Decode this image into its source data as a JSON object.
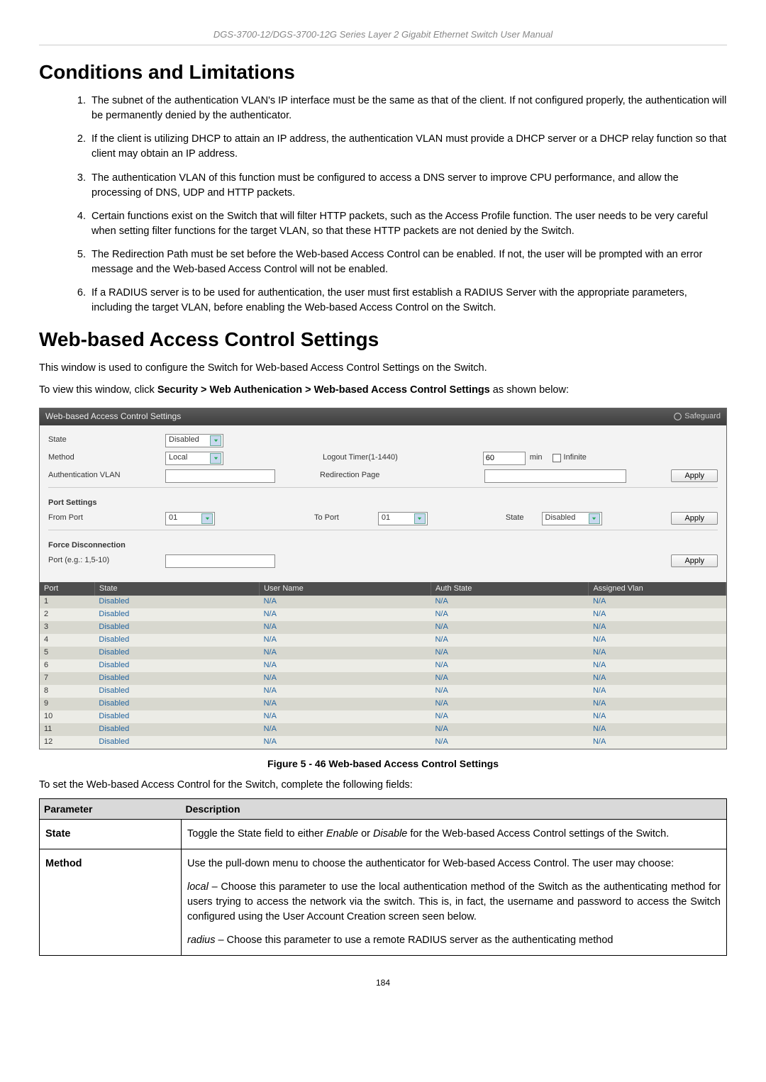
{
  "header": "DGS-3700-12/DGS-3700-12G Series Layer 2 Gigabit Ethernet Switch User Manual",
  "h1_conditions": "Conditions and Limitations",
  "conditions": [
    "The subnet of the authentication VLAN's IP interface must be the same as that of the client. If not configured properly, the authentication will be permanently denied by the authenticator.",
    "If the client is utilizing DHCP to attain an IP address, the authentication VLAN must provide a DHCP server or a DHCP relay function so that client may obtain an IP address.",
    "The authentication VLAN of this function must be configured to access a DNS server to improve CPU performance, and allow the processing of DNS, UDP and HTTP packets.",
    "Certain functions exist on the Switch that will filter HTTP packets, such as the Access Profile function. The user needs to be very careful when setting filter functions for the target VLAN, so that these HTTP packets are not denied by the Switch.",
    "The Redirection Path must be set before the Web-based Access Control can be enabled. If not, the user will be prompted with an error message and the Web-based Access Control will not be enabled.",
    "If a RADIUS server is to be used for authentication, the user must first establish a RADIUS Server with the appropriate parameters, including the target VLAN, before enabling the Web-based Access Control on the Switch."
  ],
  "h1_wbac": "Web-based Access Control Settings",
  "intro": "This window is used to configure the Switch for Web-based Access Control Settings on the Switch.",
  "navpath_prefix": "To view this window, click ",
  "navpath_bold": "Security > Web Authenication > Web-based Access Control Settings",
  "navpath_suffix": " as shown below:",
  "panel": {
    "title": "Web-based Access Control Settings",
    "safeguard": "Safeguard",
    "top": {
      "state_label": "State",
      "state_value": "Disabled",
      "method_label": "Method",
      "method_value": "Local",
      "logout_label": "Logout Timer(1-1440)",
      "logout_value": "60",
      "logout_unit": "min",
      "infinite_label": "Infinite",
      "auth_vlan_label": "Authentication VLAN",
      "redirect_label": "Redirection Page",
      "apply": "Apply"
    },
    "port_settings": {
      "title": "Port Settings",
      "from_port_label": "From Port",
      "from_port_value": "01",
      "to_port_label": "To Port",
      "to_port_value": "01",
      "state_label": "State",
      "state_value": "Disabled",
      "apply": "Apply"
    },
    "force": {
      "title": "Force Disconnection",
      "port_label": "Port (e.g.: 1,5-10)",
      "apply": "Apply"
    },
    "table": {
      "headers": [
        "Port",
        "State",
        "User Name",
        "Auth State",
        "Assigned Vlan"
      ],
      "rows": [
        {
          "port": "1",
          "state": "Disabled",
          "user": "N/A",
          "auth": "N/A",
          "vlan": "N/A"
        },
        {
          "port": "2",
          "state": "Disabled",
          "user": "N/A",
          "auth": "N/A",
          "vlan": "N/A"
        },
        {
          "port": "3",
          "state": "Disabled",
          "user": "N/A",
          "auth": "N/A",
          "vlan": "N/A"
        },
        {
          "port": "4",
          "state": "Disabled",
          "user": "N/A",
          "auth": "N/A",
          "vlan": "N/A"
        },
        {
          "port": "5",
          "state": "Disabled",
          "user": "N/A",
          "auth": "N/A",
          "vlan": "N/A"
        },
        {
          "port": "6",
          "state": "Disabled",
          "user": "N/A",
          "auth": "N/A",
          "vlan": "N/A"
        },
        {
          "port": "7",
          "state": "Disabled",
          "user": "N/A",
          "auth": "N/A",
          "vlan": "N/A"
        },
        {
          "port": "8",
          "state": "Disabled",
          "user": "N/A",
          "auth": "N/A",
          "vlan": "N/A"
        },
        {
          "port": "9",
          "state": "Disabled",
          "user": "N/A",
          "auth": "N/A",
          "vlan": "N/A"
        },
        {
          "port": "10",
          "state": "Disabled",
          "user": "N/A",
          "auth": "N/A",
          "vlan": "N/A"
        },
        {
          "port": "11",
          "state": "Disabled",
          "user": "N/A",
          "auth": "N/A",
          "vlan": "N/A"
        },
        {
          "port": "12",
          "state": "Disabled",
          "user": "N/A",
          "auth": "N/A",
          "vlan": "N/A"
        }
      ]
    }
  },
  "figure_caption": "Figure 5 - 46 Web-based Access Control Settings",
  "instr": "To set the Web-based Access Control for the Switch, complete the following fields:",
  "param_table": {
    "headers": {
      "param": "Parameter",
      "desc": "Description"
    },
    "rows": [
      {
        "name": "State",
        "parts": [
          {
            "plain": "Toggle the State field to either "
          },
          {
            "italic": "Enable"
          },
          {
            "plain": " or "
          },
          {
            "italic": "Disable"
          },
          {
            "plain": " for the Web-based Access Control settings of the Switch."
          }
        ]
      },
      {
        "name": "Method",
        "parts": [
          {
            "plain": "Use the pull-down menu to choose the authenticator for Web-based Access Control. The user may choose:"
          }
        ],
        "sub": [
          [
            {
              "italic": "local"
            },
            {
              "plain": " – Choose this parameter to use the local authentication method of the Switch as the authenticating method for users trying to access the network via the switch. This is, in fact, the username and password to access the Switch configured using the User Account Creation screen seen below."
            }
          ],
          [
            {
              "italic": "radius"
            },
            {
              "plain": " – Choose this parameter to use a remote RADIUS server as the authenticating method"
            }
          ]
        ]
      }
    ]
  },
  "page_number": "184"
}
